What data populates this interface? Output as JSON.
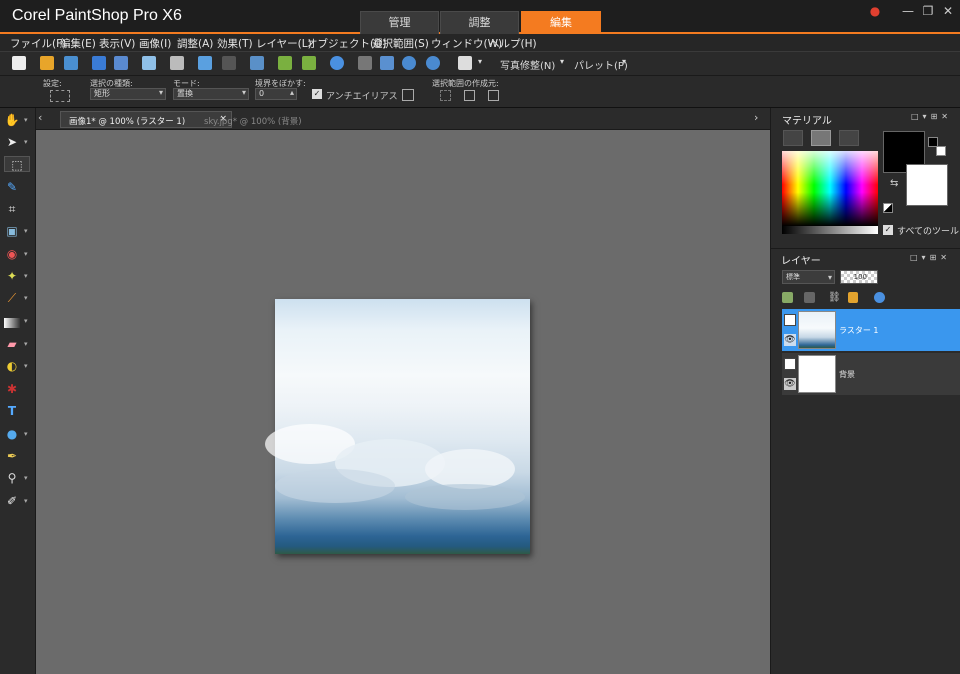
{
  "app": {
    "title": "Corel PaintShop Pro X6"
  },
  "workspace_tabs": [
    "管理",
    "調整",
    "編集"
  ],
  "active_workspace": "編集",
  "menu": [
    "ファイル(F)",
    "編集(E)",
    "表示(V)",
    "画像(I)",
    "調整(A)",
    "効果(T)",
    "レイヤー(L)",
    "オブジェクト(O)",
    "選択範囲(S)",
    "ウィンドウ(W)",
    "ヘルプ(H)"
  ],
  "toolbar": {
    "photo_fix": "写真修整(N)",
    "palette": "パレット(P)"
  },
  "options": {
    "preset_label": "設定:",
    "selection_type_label": "選択の種類:",
    "selection_type_value": "矩形",
    "mode_label": "モード:",
    "mode_value": "置換",
    "feather_label": "境界をぼかす:",
    "feather_value": "0",
    "antialias_label": "アンチエイリアス",
    "create_from_label": "選択範囲の作成元:"
  },
  "doc_tabs": [
    {
      "label": "画像1* @ 100% (ラスター 1)",
      "close": "×"
    },
    {
      "label": "sky.jpg* @ 100% (背景)"
    }
  ],
  "materials": {
    "title": "マテリアル",
    "all_tools_label": "すべてのツール"
  },
  "layers": {
    "title": "レイヤー",
    "blend_mode": "標準",
    "opacity": "100",
    "items": [
      {
        "name": "ラスター 1",
        "selected": true
      },
      {
        "name": "背景",
        "selected": false
      }
    ]
  },
  "colors": {
    "accent": "#f47b20",
    "selection": "#3a97ee",
    "canvas_bg": "#6b6b6b"
  }
}
